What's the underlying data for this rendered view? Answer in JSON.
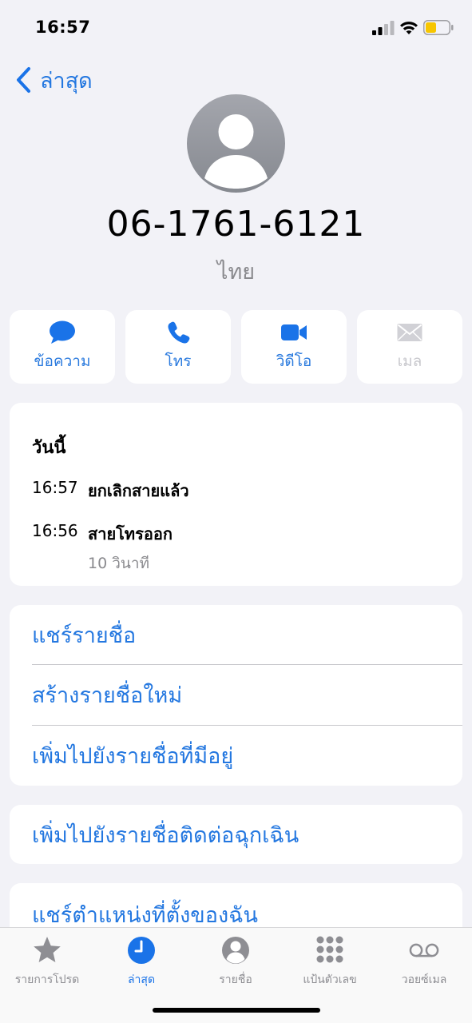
{
  "status_bar": {
    "time": "16:57"
  },
  "nav": {
    "back_label": "ล่าสุด"
  },
  "contact": {
    "number": "06-1761-6121",
    "region": "ไทย"
  },
  "actions": [
    {
      "label": "ข้อความ",
      "icon": "message-icon",
      "enabled": true
    },
    {
      "label": "โทร",
      "icon": "phone-icon",
      "enabled": true
    },
    {
      "label": "วิดีโอ",
      "icon": "video-icon",
      "enabled": true
    },
    {
      "label": "เมล",
      "icon": "mail-icon",
      "enabled": false
    }
  ],
  "history": {
    "title": "วันนี้",
    "entries": [
      {
        "time": "16:57",
        "description": "ยกเลิกสายแล้ว"
      },
      {
        "time": "16:56",
        "description": "สายโทรออก",
        "detail": "10 วินาที"
      }
    ]
  },
  "menu": {
    "share_contact": "แชร์รายชื่อ",
    "create_contact": "สร้างรายชื่อใหม่",
    "add_existing": "เพิ่มไปยังรายชื่อที่มีอยู่",
    "add_emergency": "เพิ่มไปยังรายชื่อติดต่อฉุกเฉิน",
    "share_location": "แชร์ตำแหน่งที่ตั้งของฉัน"
  },
  "tabs": [
    {
      "label": "รายการโปรด",
      "icon": "star-icon",
      "active": false
    },
    {
      "label": "ล่าสุด",
      "icon": "clock-icon",
      "active": true
    },
    {
      "label": "รายชื่อ",
      "icon": "contact-icon",
      "active": false
    },
    {
      "label": "แป้นตัวเลข",
      "icon": "keypad-icon",
      "active": false
    },
    {
      "label": "วอยซ์เมล",
      "icon": "voicemail-icon",
      "active": false
    }
  ],
  "colors": {
    "accent": "#1a73e8",
    "background": "#f2f2f7",
    "battery": "#f7c600"
  }
}
